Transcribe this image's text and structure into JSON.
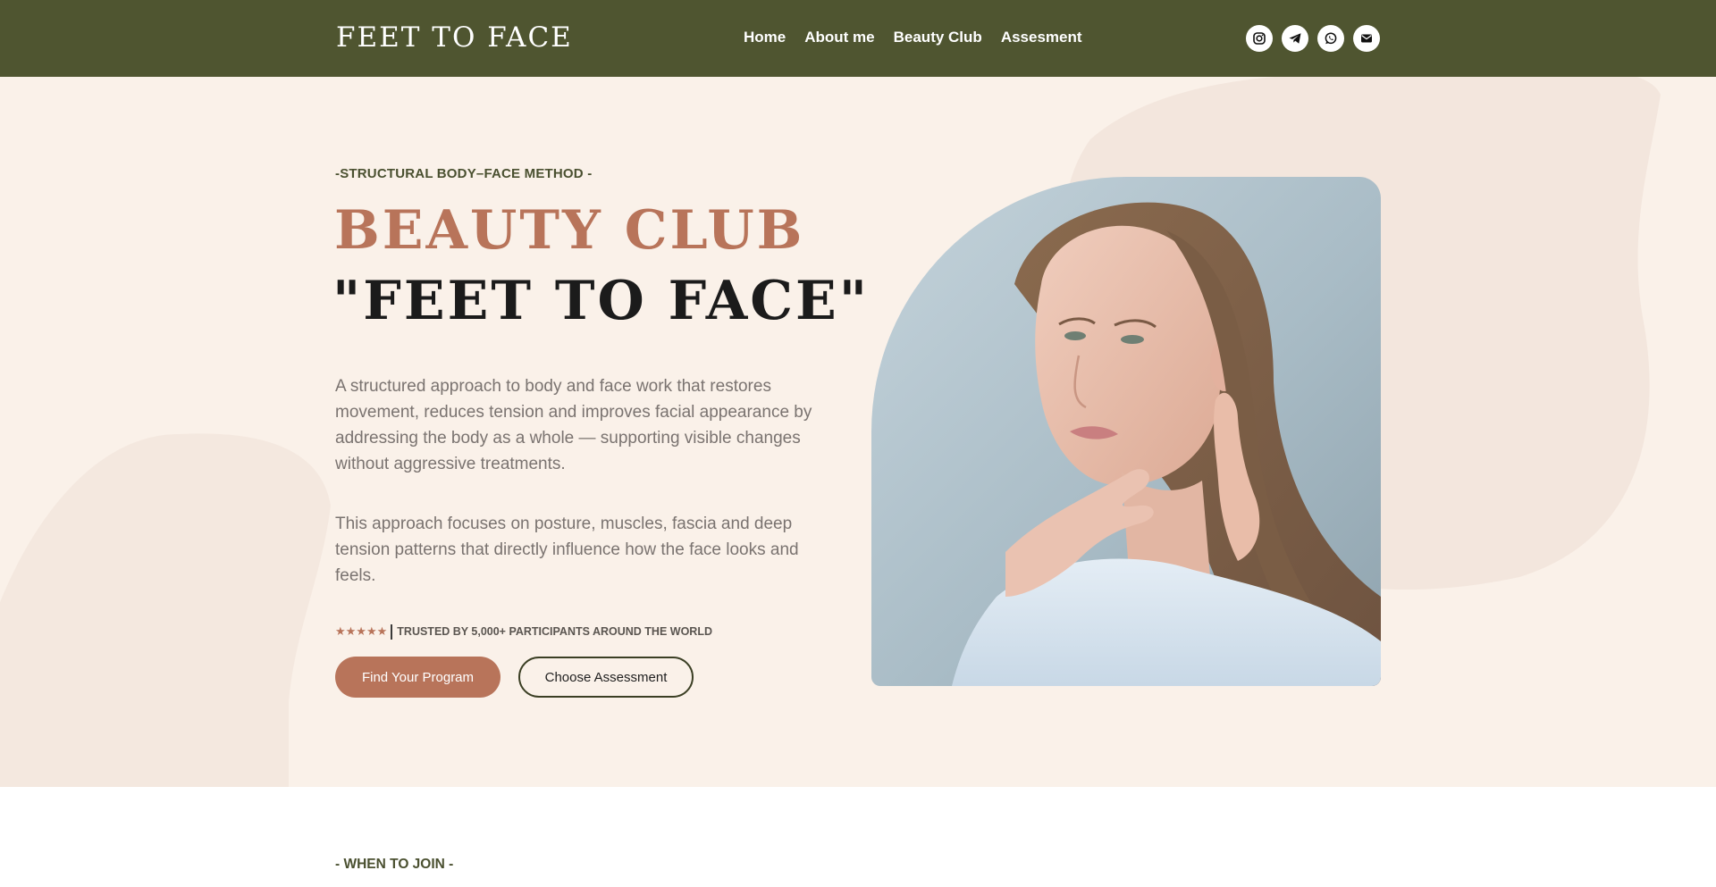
{
  "header": {
    "logo": "FEET TO FACE",
    "nav": [
      {
        "label": "Home"
      },
      {
        "label": "About me"
      },
      {
        "label": "Beauty Club"
      },
      {
        "label": "Assesment"
      }
    ],
    "socials": [
      {
        "icon": "instagram-icon"
      },
      {
        "icon": "telegram-icon"
      },
      {
        "icon": "whatsapp-icon"
      },
      {
        "icon": "email-icon"
      }
    ]
  },
  "hero": {
    "eyebrow": "-STRUCTURAL BODY–FACE METHOD -",
    "title_line_1": "BEAUTY CLUB",
    "title_line_2": "\"FEET TO FACE\"",
    "paragraph_1": "A structured approach to body and face work that restores movement, reduces tension and improves facial appearance by addressing the body as a whole — supporting visible changes without aggressive treatments.",
    "paragraph_2": "This approach focuses on posture, muscles, fascia and deep tension patterns that directly influence how the face looks and feels.",
    "rating_stars": "★★★★★",
    "rating": 5,
    "trust_text": "TRUSTED BY 5,000+ PARTICIPANTS AROUND THE WORLD",
    "primary_button": "Find Your Program",
    "secondary_button": "Choose Assessment"
  },
  "next_section": {
    "eyebrow": "- WHEN TO JOIN -"
  },
  "colors": {
    "header_bg": "#4f5530",
    "hero_bg": "#faf1e9",
    "accent": "#b8745a",
    "dark_text": "#1b1b1b",
    "olive_text": "#4a5030"
  }
}
